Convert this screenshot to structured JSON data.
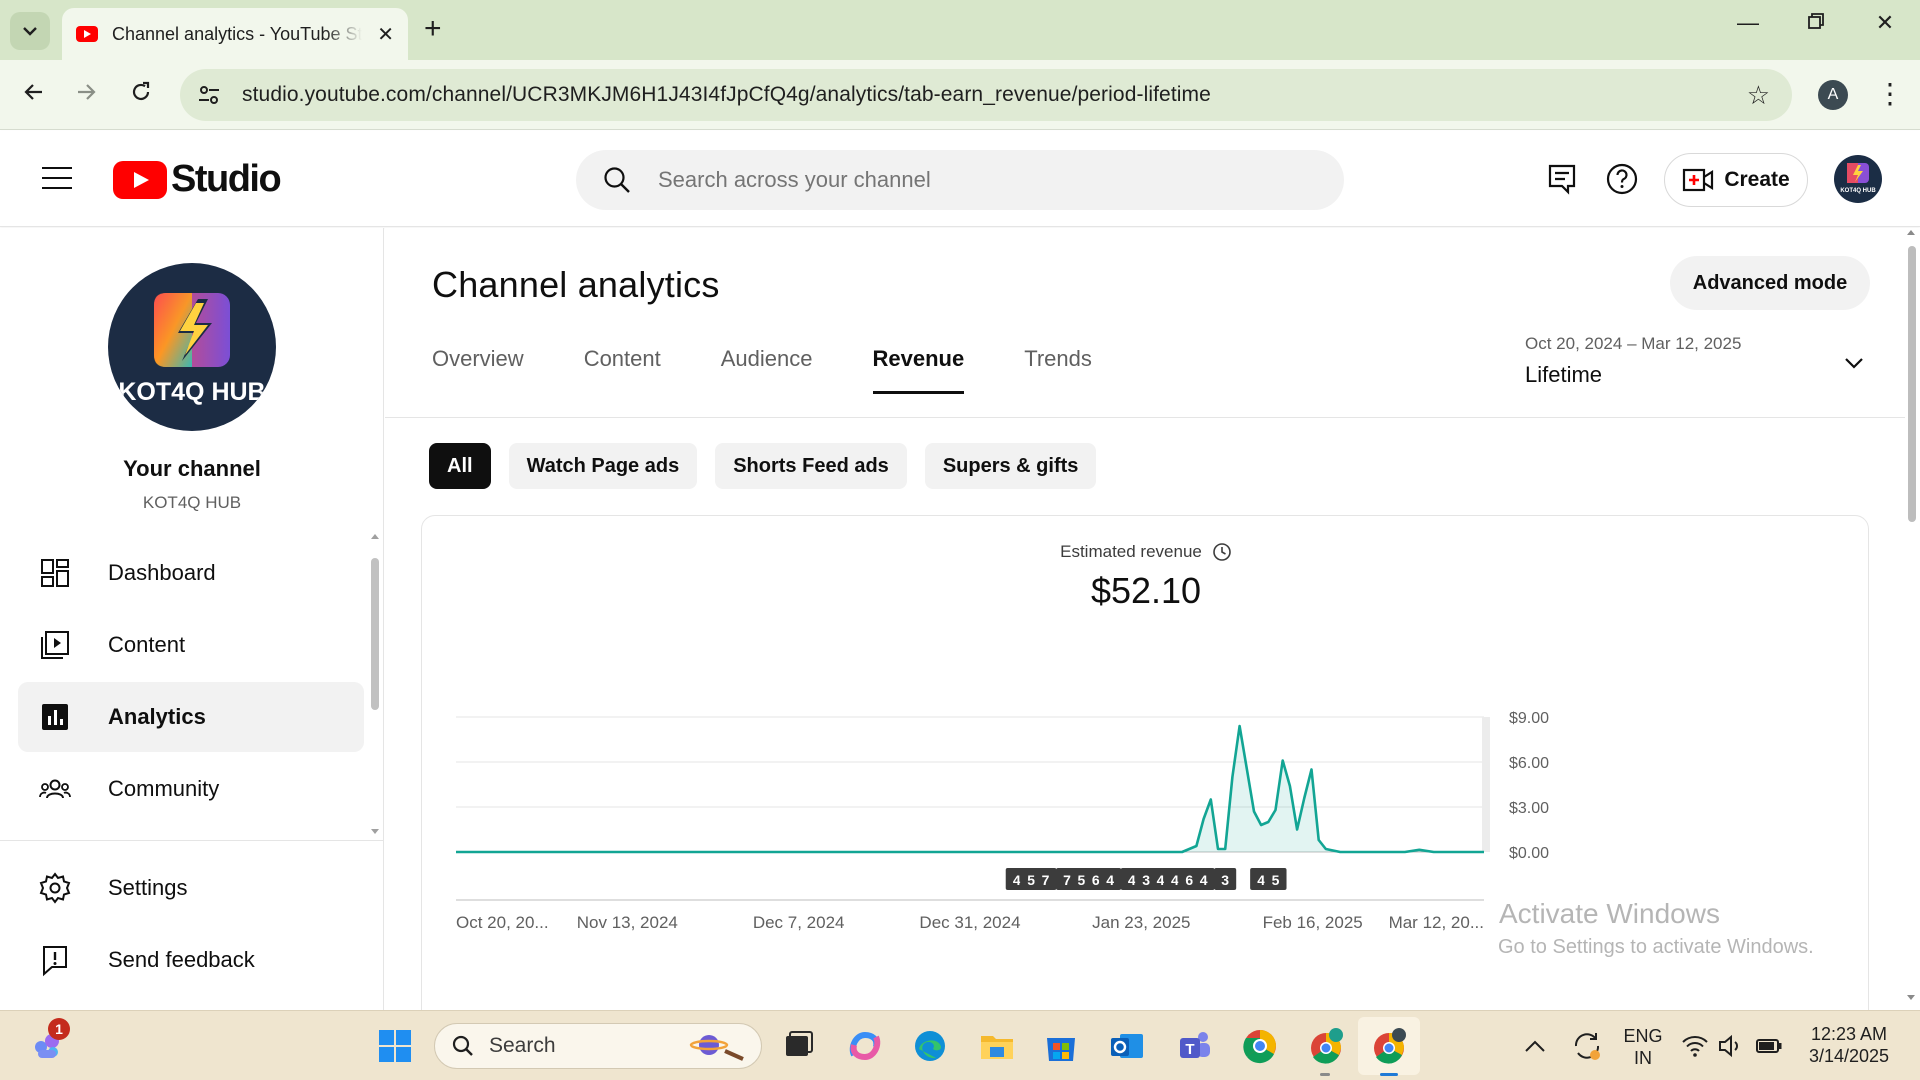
{
  "browser": {
    "tab_title": "Channel analytics - YouTube Studio",
    "url": "studio.youtube.com/channel/UCR3MKJM6H1J43I4fJpCfQ4g/analytics/tab-earn_revenue/period-lifetime",
    "profile_initial": "A"
  },
  "header": {
    "logo_text": "Studio",
    "search_placeholder": "Search across your channel",
    "create_label": "Create"
  },
  "sidebar": {
    "avatar_text": "KOT4Q HUB",
    "channel_title": "Your channel",
    "channel_name": "KOT4Q HUB",
    "items": [
      {
        "label": "Dashboard",
        "icon": "dashboard-icon"
      },
      {
        "label": "Content",
        "icon": "content-icon"
      },
      {
        "label": "Analytics",
        "icon": "analytics-icon",
        "active": true
      },
      {
        "label": "Community",
        "icon": "community-icon"
      }
    ],
    "footer_items": [
      {
        "label": "Settings",
        "icon": "gear-icon"
      },
      {
        "label": "Send feedback",
        "icon": "feedback-icon"
      }
    ]
  },
  "main": {
    "title": "Channel analytics",
    "advanced_mode_label": "Advanced mode",
    "tabs": [
      {
        "label": "Overview"
      },
      {
        "label": "Content"
      },
      {
        "label": "Audience"
      },
      {
        "label": "Revenue",
        "active": true
      },
      {
        "label": "Trends"
      }
    ],
    "period": {
      "range": "Oct 20, 2024 – Mar 12, 2025",
      "label": "Lifetime"
    },
    "chips": [
      {
        "label": "All",
        "active": true
      },
      {
        "label": "Watch Page ads"
      },
      {
        "label": "Shorts Feed ads"
      },
      {
        "label": "Supers & gifts"
      }
    ],
    "metric": {
      "label": "Estimated revenue",
      "value": "$52.10"
    }
  },
  "chart_data": {
    "type": "area",
    "x_tick_labels": [
      "Oct 20, 20...",
      "Nov 13, 2024",
      "Dec 7, 2024",
      "Dec 31, 2024",
      "Jan 23, 2025",
      "Feb 16, 2025",
      "Mar 12, 20..."
    ],
    "y_tick_labels": [
      "$0.00",
      "$3.00",
      "$6.00",
      "$9.00"
    ],
    "ylim": [
      0,
      9
    ],
    "x_range": [
      "2024-10-20",
      "2025-03-12"
    ],
    "series": [
      {
        "color": "#12a594",
        "points": [
          [
            "2024-10-20",
            0
          ],
          [
            "2025-01-29",
            0
          ],
          [
            "2025-01-31",
            0.4
          ],
          [
            "2025-02-01",
            2.2
          ],
          [
            "2025-02-02",
            3.5
          ],
          [
            "2025-02-03",
            0.2
          ],
          [
            "2025-02-04",
            0.2
          ],
          [
            "2025-02-05",
            5.0
          ],
          [
            "2025-02-06",
            8.4
          ],
          [
            "2025-02-08",
            2.7
          ],
          [
            "2025-02-09",
            1.8
          ],
          [
            "2025-02-10",
            2.0
          ],
          [
            "2025-02-11",
            2.8
          ],
          [
            "2025-02-12",
            6.1
          ],
          [
            "2025-02-13",
            4.4
          ],
          [
            "2025-02-14",
            1.5
          ],
          [
            "2025-02-15",
            3.6
          ],
          [
            "2025-02-16",
            5.5
          ],
          [
            "2025-02-17",
            0.8
          ],
          [
            "2025-02-18",
            0.2
          ],
          [
            "2025-02-20",
            0
          ],
          [
            "2025-03-01",
            0
          ],
          [
            "2025-03-03",
            0.15
          ],
          [
            "2025-03-05",
            0
          ],
          [
            "2025-03-12",
            0
          ]
        ]
      }
    ],
    "markers": [
      {
        "date": "2025-01-06",
        "label": "4"
      },
      {
        "date": "2025-01-08",
        "label": "5"
      },
      {
        "date": "2025-01-10",
        "label": "7"
      },
      {
        "date": "2025-01-13",
        "label": "7"
      },
      {
        "date": "2025-01-15",
        "label": "5"
      },
      {
        "date": "2025-01-17",
        "label": "6"
      },
      {
        "date": "2025-01-19",
        "label": "4"
      },
      {
        "date": "2025-01-22",
        "label": "4"
      },
      {
        "date": "2025-01-24",
        "label": "3"
      },
      {
        "date": "2025-01-26",
        "label": "4"
      },
      {
        "date": "2025-01-28",
        "label": "4"
      },
      {
        "date": "2025-01-30",
        "label": "6"
      },
      {
        "date": "2025-02-01",
        "label": "4"
      },
      {
        "date": "2025-02-04",
        "label": "3"
      },
      {
        "date": "2025-02-09",
        "label": "4"
      },
      {
        "date": "2025-02-11",
        "label": "5"
      }
    ],
    "legend": "none",
    "grid": true
  },
  "watermark": {
    "line1": "Activate Windows",
    "line2": "Go to Settings to activate Windows."
  },
  "taskbar": {
    "search_label": "Search",
    "lang_line1": "ENG",
    "lang_line2": "IN",
    "time": "12:23 AM",
    "date": "3/14/2025",
    "notification_count": "1"
  }
}
